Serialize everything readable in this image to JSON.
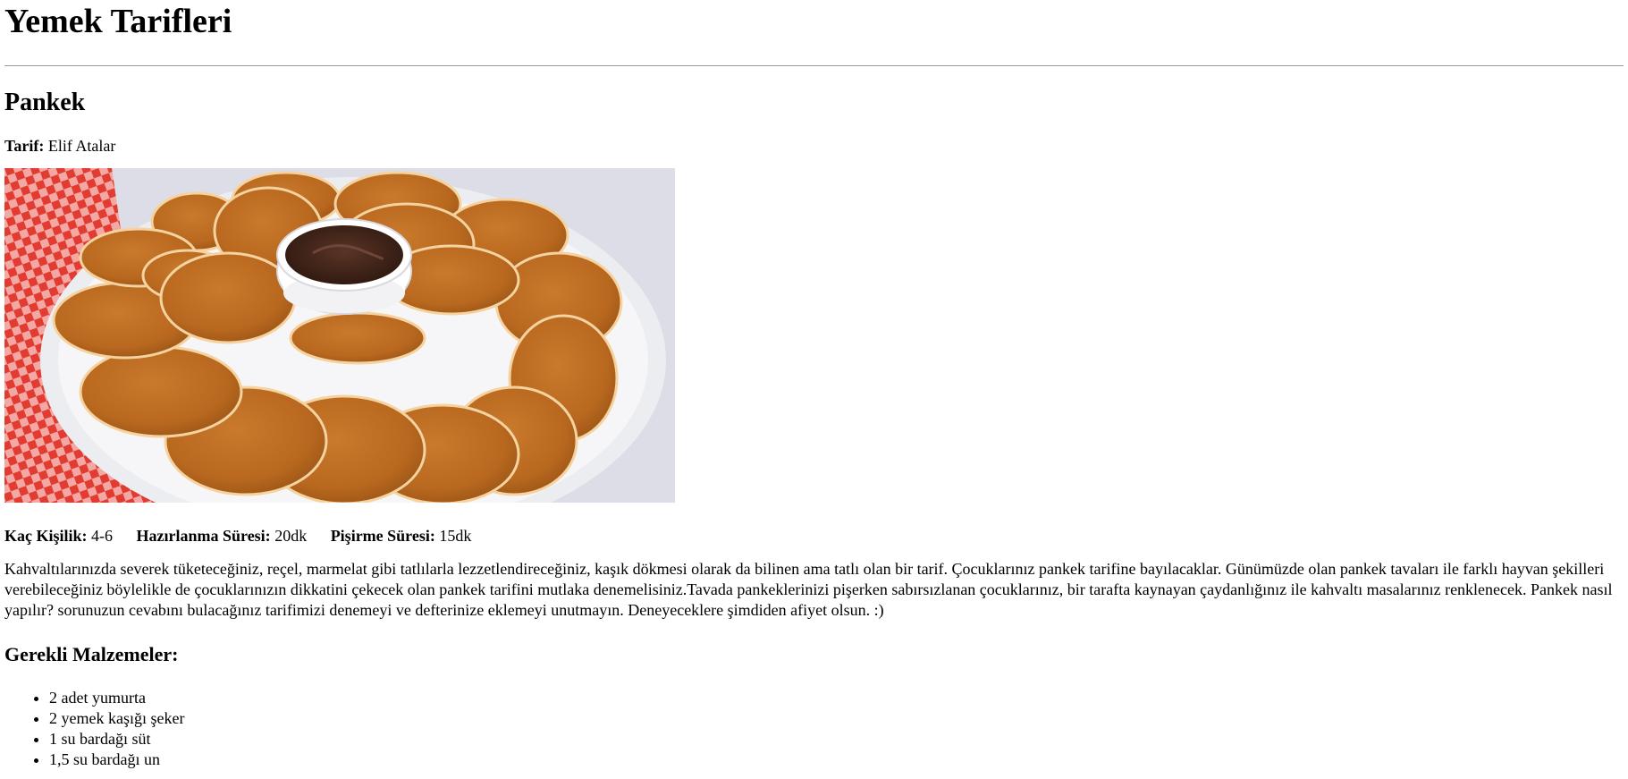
{
  "site": {
    "title": "Yemek Tarifleri"
  },
  "recipe": {
    "title": "Pankek",
    "author_label": "Tarif:",
    "author_name": "Elif Atalar",
    "image_alt": "pancakes-photo",
    "stats": {
      "servings_label": "Kaç Kişilik:",
      "servings_value": "4-6",
      "prep_label": "Hazırlanma Süresi:",
      "prep_value": "20dk",
      "cook_label": "Pişirme Süresi:",
      "cook_value": "15dk"
    },
    "description": "Kahvaltılarınızda severek tüketeceğiniz, reçel, marmelat gibi tatlılarla lezzetlendireceğiniz, kaşık dökmesi olarak da bilinen ama tatlı olan bir tarif. Çocuklarınız pankek tarifine bayılacaklar. Günümüzde olan pankek tavaları ile farklı hayvan şekilleri verebileceğiniz böylelikle de çocuklarınızın dikkatini çekecek olan pankek tarifini mutlaka denemelisiniz.Tavada pankeklerinizi pişerken sabırsızlanan çocuklarınız, bir tarafta kaynayan çaydanlığınız ile kahvaltı masalarınız renklenecek. Pankek nasıl yapılır? sorunuzun cevabını bulacağınız tarifimizi denemeyi ve defterinize eklemeyi unutmayın. Deneyeceklere şimdiden afiyet olsun. :)",
    "ingredients_heading": "Gerekli Malzemeler:",
    "ingredients": [
      "2 adet yumurta",
      "2 yemek kaşığı şeker",
      "1 su bardağı süt",
      "1,5 su bardağı un"
    ]
  }
}
